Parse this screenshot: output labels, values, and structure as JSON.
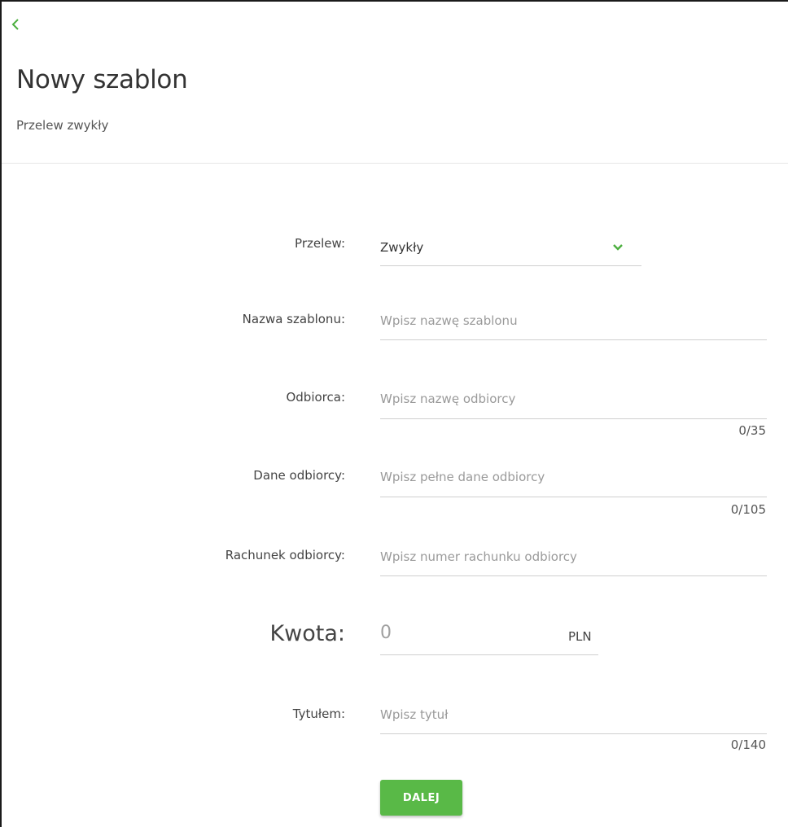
{
  "header": {
    "back_icon": "chevron-left-icon",
    "title": "Nowy szablon",
    "subtitle": "Przelew zwykły"
  },
  "form": {
    "transfer_type": {
      "label": "Przelew:",
      "value": "Zwykły",
      "icon": "chevron-down-icon"
    },
    "template_name": {
      "label": "Nazwa szablonu:",
      "placeholder": "Wpisz nazwę szablonu"
    },
    "recipient": {
      "label": "Odbiorca:",
      "placeholder": "Wpisz nazwę odbiorcy",
      "counter": "0/35"
    },
    "recipient_details": {
      "label": "Dane odbiorcy:",
      "placeholder": "Wpisz pełne dane odbiorcy",
      "counter": "0/105"
    },
    "recipient_account": {
      "label": "Rachunek odbiorcy:",
      "placeholder": "Wpisz numer rachunku odbiorcy"
    },
    "amount": {
      "label": "Kwota:",
      "placeholder": "0",
      "currency": "PLN"
    },
    "title_field": {
      "label": "Tytułem:",
      "placeholder": "Wpisz tytuł",
      "counter": "0/140"
    },
    "next_button": "DALEJ"
  },
  "colors": {
    "accent": "#59b947",
    "text": "#333333",
    "placeholder": "#9a9a9a",
    "underline": "#cfcfcf"
  }
}
